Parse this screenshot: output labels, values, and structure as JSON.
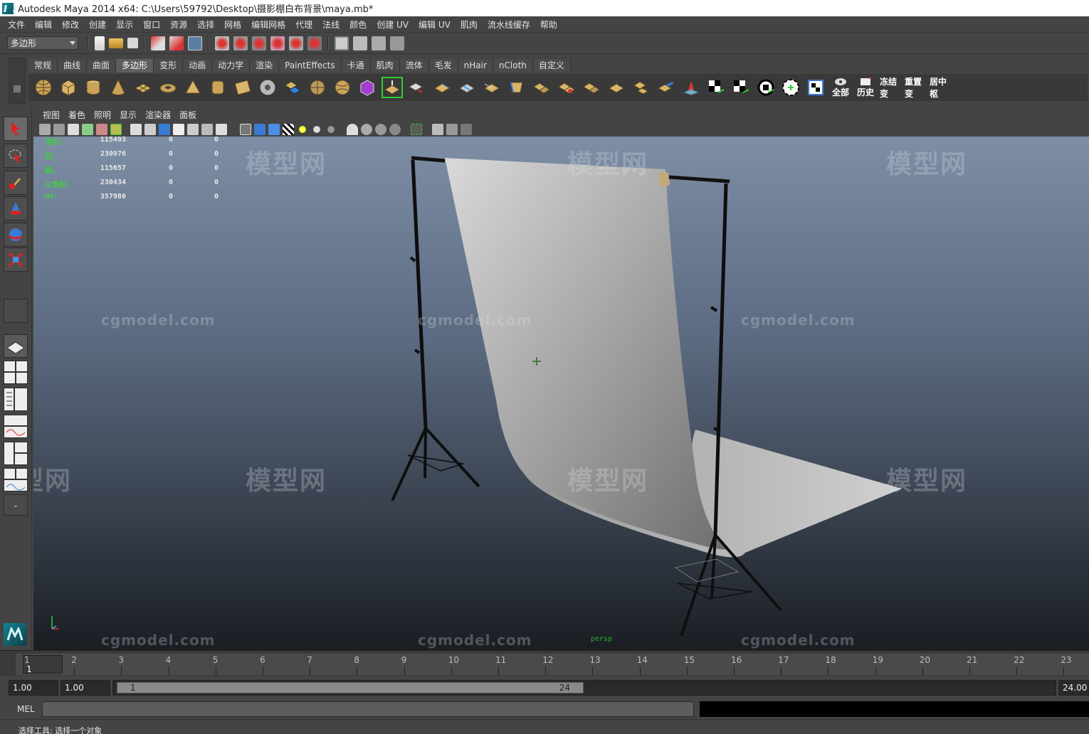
{
  "window": {
    "title": "Autodesk Maya 2014 x64: C:\\Users\\59792\\Desktop\\摄影棚白布背景\\maya.mb*"
  },
  "menubar": {
    "items": [
      "文件",
      "编辑",
      "修改",
      "创建",
      "显示",
      "窗口",
      "资源",
      "选择",
      "网格",
      "编辑网格",
      "代理",
      "法线",
      "颜色",
      "创建 UV",
      "编辑 UV",
      "肌肉",
      "流水线缓存",
      "帮助"
    ]
  },
  "statusline": {
    "mode": "多边形"
  },
  "shelf": {
    "tabs": [
      "常规",
      "曲线",
      "曲面",
      "多边形",
      "变形",
      "动画",
      "动力学",
      "渲染",
      "PaintEffects",
      "卡通",
      "肌肉",
      "流体",
      "毛发",
      "nHair",
      "nCloth",
      "自定义"
    ],
    "active_tab": "多边形",
    "labels": [
      "全部",
      "历史",
      "冻结变",
      "重置变",
      "居中枢"
    ]
  },
  "panel": {
    "menu": [
      "视图",
      "着色",
      "照明",
      "显示",
      "渲染器",
      "面板"
    ]
  },
  "hud": {
    "rows": [
      {
        "label": "顶点:",
        "v1": "115493",
        "v2": "0",
        "v3": "0"
      },
      {
        "label": "边:",
        "v1": "230976",
        "v2": "0",
        "v3": "0"
      },
      {
        "label": "面:",
        "v1": "115657",
        "v2": "0",
        "v3": "0"
      },
      {
        "label": "三角形:",
        "v1": "230434",
        "v2": "0",
        "v3": "0"
      },
      {
        "label": "UV:",
        "v1": "357986",
        "v2": "0",
        "v3": "0"
      }
    ]
  },
  "watermarks": {
    "logo": "模型网",
    "url": "cgmodel.com"
  },
  "viewport": {
    "camera": "persp"
  },
  "timeline": {
    "ticks": [
      "1",
      "2",
      "3",
      "4",
      "5",
      "6",
      "7",
      "8",
      "9",
      "10",
      "11",
      "12",
      "13",
      "14",
      "15",
      "16",
      "17",
      "18",
      "19",
      "20",
      "21",
      "22",
      "23"
    ],
    "current_frame": "1"
  },
  "range": {
    "start": "1.00",
    "playback_start": "1.00",
    "thumb_start": "1",
    "thumb_end": "24",
    "end": "24.00"
  },
  "cmdline": {
    "label": "MEL"
  },
  "helpline": {
    "text": "选择工具: 选择一个对象"
  },
  "colors": {
    "ui_bg": "#444444",
    "hud_label": "#3ed13e",
    "viewport_top": "#7d8ea5",
    "viewport_bottom": "#1a1e23"
  }
}
